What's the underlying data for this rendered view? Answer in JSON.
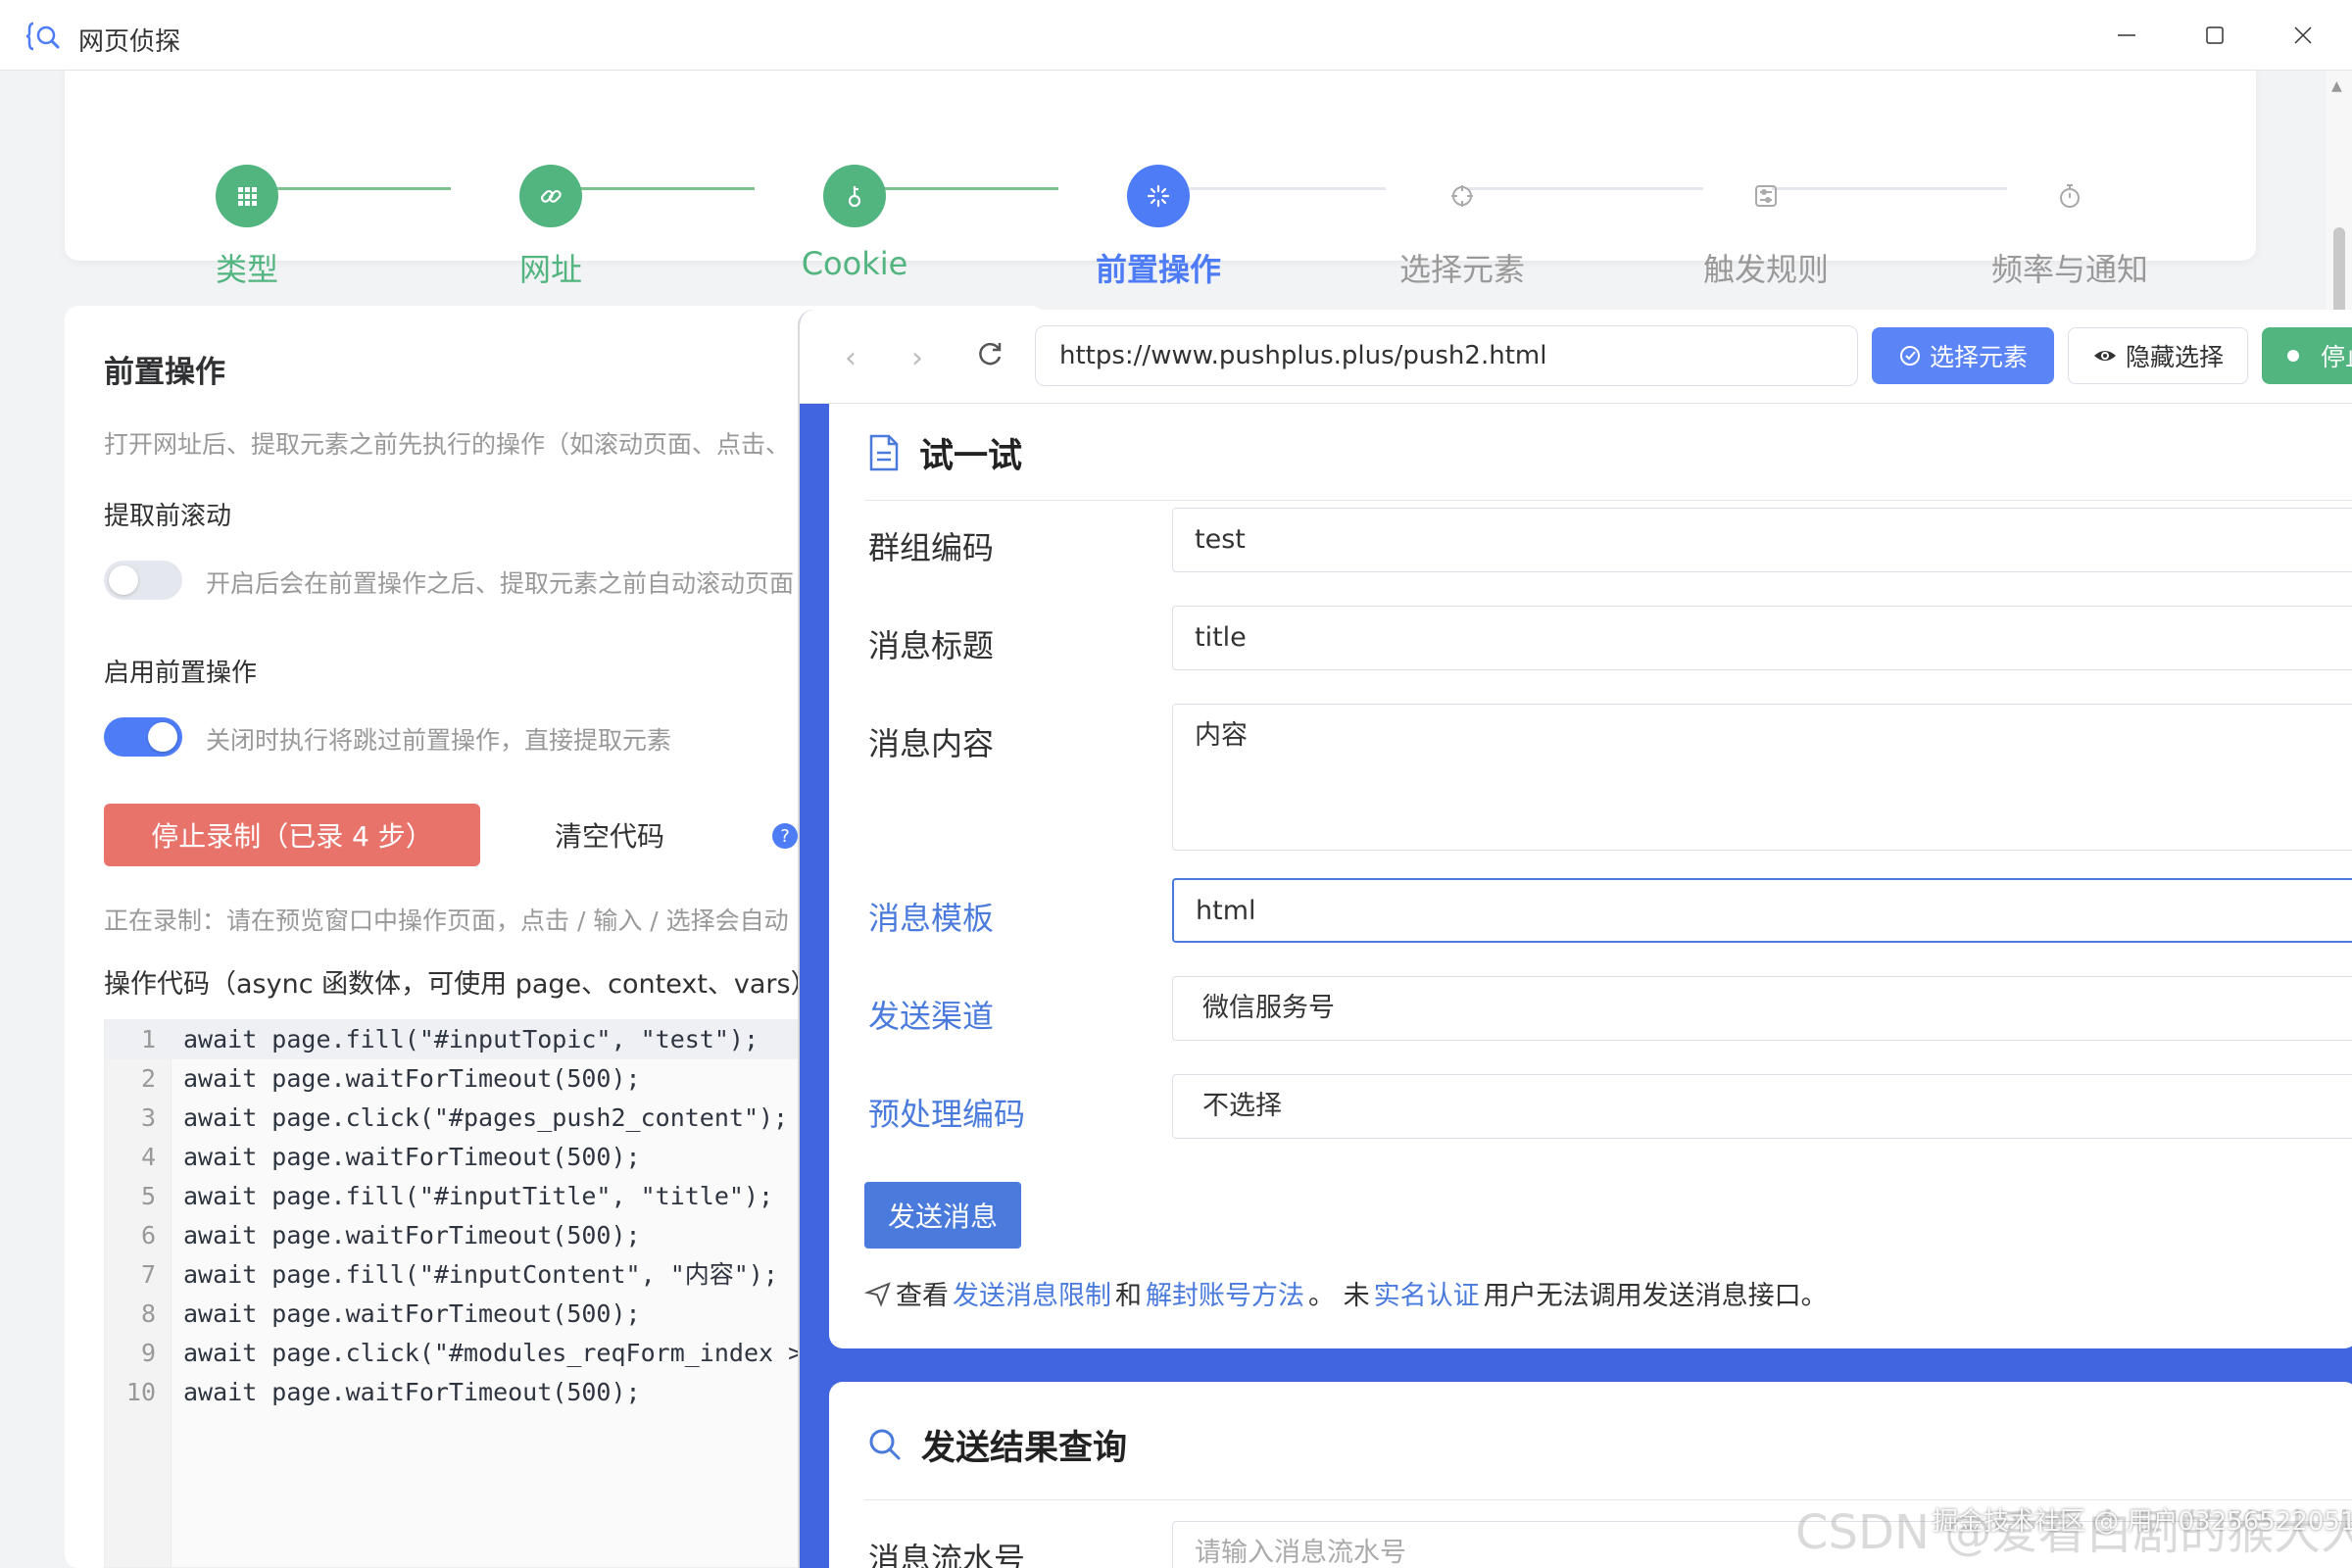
{
  "window": {
    "title": "网页侦探",
    "icon": "magnifier-app-icon"
  },
  "steps": [
    {
      "label": "类型",
      "state": "done",
      "icon": "grid-icon"
    },
    {
      "label": "网址",
      "state": "done",
      "icon": "link-icon"
    },
    {
      "label": "Cookie",
      "state": "done",
      "icon": "key-icon"
    },
    {
      "label": "前置操作",
      "state": "active",
      "icon": "loading-icon"
    },
    {
      "label": "选择元素",
      "state": "todo",
      "icon": "crosshair-icon"
    },
    {
      "label": "触发规则",
      "state": "todo",
      "icon": "sliders-icon"
    },
    {
      "label": "频率与通知",
      "state": "todo",
      "icon": "timer-icon"
    }
  ],
  "left": {
    "title": "前置操作",
    "desc": "打开网址后、提取元素之前先执行的操作（如滚动页面、点击、",
    "scroll_label": "提取前滚动",
    "scroll_desc": "开启后会在前置操作之后、提取元素之前自动滚动页面",
    "enable_label": "启用前置操作",
    "enable_desc": "关闭时执行将跳过前置操作，直接提取元素",
    "stop_button": "停止录制（已录 4 步）",
    "clear_button": "清空代码",
    "help": "?",
    "rec_status": "正在录制：请在预览窗口中操作页面，点击 / 输入 / 选择会自动",
    "code_label": "操作代码（async 函数体，可使用 page、context、vars）",
    "code_lines": [
      {
        "n": "1",
        "text": "await page.fill(\"#inputTopic\", \"test\");"
      },
      {
        "n": "2",
        "text": "await page.waitForTimeout(500);"
      },
      {
        "n": "3",
        "text": "await page.click(\"#pages_push2_content\");"
      },
      {
        "n": "4",
        "text": "await page.waitForTimeout(500);"
      },
      {
        "n": "5",
        "text": "await page.fill(\"#inputTitle\", \"title\");"
      },
      {
        "n": "6",
        "text": "await page.waitForTimeout(500);"
      },
      {
        "n": "7",
        "text": "await page.fill(\"#inputContent\", \"内容\");"
      },
      {
        "n": "8",
        "text": "await page.waitForTimeout(500);"
      },
      {
        "n": "9",
        "text": "await page.click(\"#modules_reqForm_index > d"
      },
      {
        "n": "10",
        "text": "await page.waitForTimeout(500);"
      }
    ]
  },
  "preview": {
    "url": "https://www.pushplus.plus/push2.html",
    "select_button": "选择元素",
    "hide_button": "隐藏选择",
    "stop_button": "停止",
    "try": {
      "title": "试一试",
      "fields": [
        {
          "label": "群组编码",
          "value": "test"
        },
        {
          "label": "消息标题",
          "value": "title"
        },
        {
          "label": "消息内容",
          "value": "内容"
        },
        {
          "label": "消息模板",
          "value": "html"
        },
        {
          "label": "发送渠道",
          "value": "微信服务号"
        },
        {
          "label": "预处理编码",
          "value": "不选择"
        }
      ],
      "send_button": "发送消息",
      "tip": {
        "p1": "查看",
        "link1": "发送消息限制",
        "p2": "和",
        "link2": "解封账号方法",
        "p3": "。 未",
        "link3": "实名认证",
        "p4": "用户无法调用发送消息接口。"
      }
    },
    "result": {
      "title": "发送结果查询",
      "field_label": "消息流水号",
      "field_placeholder": "请输入消息流水号"
    }
  },
  "watermark": "CSDN @爱看白剧的猴大人",
  "watermark2": "掘金技术社区 @ 用户03256522051"
}
